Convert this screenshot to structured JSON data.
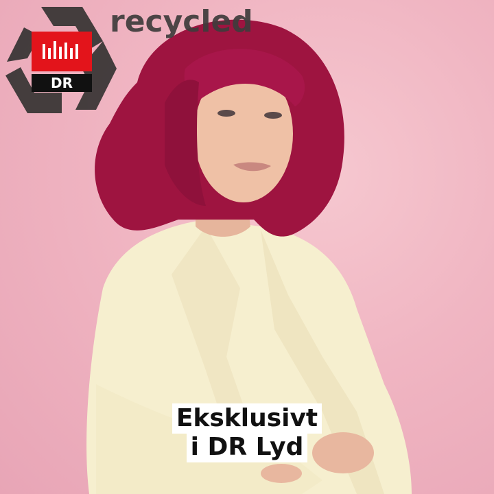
{
  "overlay": {
    "recycled_label": "recycled",
    "logo_icon": "recycle-icon"
  },
  "brand": {
    "logo_text": "DR",
    "accent_color": "#e3141b"
  },
  "caption": {
    "line1": "Eksklusivt",
    "line2": "i DR Lyd"
  },
  "colors": {
    "background": "#f0b5c2",
    "hair": "#9e1440",
    "blazer": "#f6efcf",
    "caption_bg": "#ffffff",
    "caption_text": "#111111"
  }
}
